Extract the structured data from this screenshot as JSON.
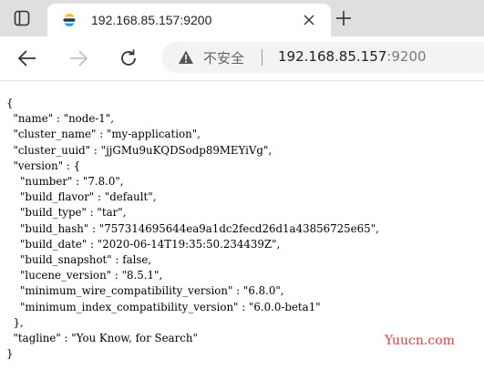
{
  "browser": {
    "tab": {
      "title": "192.168.85.157:9200"
    },
    "address_bar": {
      "security_label": "不安全",
      "url_host": "192.168.85.157",
      "url_port": ":9200"
    },
    "icons": {
      "tab_strip": "tab-strip-icon",
      "favicon": "elasticsearch-favicon",
      "close": "close-icon",
      "new_tab": "plus-icon",
      "back": "back-arrow-icon",
      "forward": "forward-arrow-icon",
      "reload": "reload-icon",
      "warning": "warning-icon"
    }
  },
  "response": {
    "name": "node-1",
    "cluster_name": "my-application",
    "cluster_uuid": "jjGMu9uKQDSodp89MEYiVg",
    "version": {
      "number": "7.8.0",
      "build_flavor": "default",
      "build_type": "tar",
      "build_hash": "757314695644ea9a1dc2fecd26d1a43856725e65",
      "build_date": "2020-06-14T19:35:50.234439Z",
      "build_snapshot": "false",
      "lucene_version": "8.5.1",
      "minimum_wire_compatibility_version": "6.8.0",
      "minimum_index_compatibility_version": "6.0.0-beta1"
    },
    "tagline": "You Know, for Search"
  },
  "watermark": "Yuucn.com"
}
